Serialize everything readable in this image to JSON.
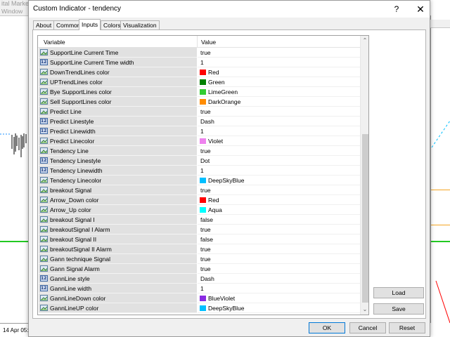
{
  "background": {
    "app_title_fragment": "ital Marke",
    "menu_fragment": "Window",
    "axis_label": "14 Apr 05:0"
  },
  "dialog": {
    "title": "Custom Indicator - tendency",
    "help_label": "?",
    "close_label": "✕",
    "tabs": [
      {
        "label": "About",
        "active": false
      },
      {
        "label": "Common",
        "active": false
      },
      {
        "label": "Inputs",
        "active": true
      },
      {
        "label": "Colors",
        "active": false
      },
      {
        "label": "Visualization",
        "active": false
      }
    ],
    "table": {
      "columns": {
        "variable": "Variable",
        "value": "Value"
      },
      "rows": [
        {
          "icon": "bool",
          "name": "SupportLine Current Time",
          "value": "true"
        },
        {
          "icon": "num",
          "name": "SupportLine Current Time width",
          "value": "1"
        },
        {
          "icon": "color",
          "name": "DownTrendLines color",
          "value": "Red",
          "swatch": "#ff0000"
        },
        {
          "icon": "color",
          "name": "UPTrendLines color",
          "value": "Green",
          "swatch": "#008000"
        },
        {
          "icon": "color",
          "name": "Bye SupportLines color",
          "value": "LimeGreen",
          "swatch": "#32cd32"
        },
        {
          "icon": "color",
          "name": "Sell SupportLines color",
          "value": "DarkOrange",
          "swatch": "#ff8c00"
        },
        {
          "icon": "bool",
          "name": "Predict Line",
          "value": "true"
        },
        {
          "icon": "num",
          "name": "Predict Linestyle",
          "value": "Dash"
        },
        {
          "icon": "num",
          "name": "Predict Linewidth",
          "value": "1"
        },
        {
          "icon": "color",
          "name": "Predict Linecolor",
          "value": "Violet",
          "swatch": "#ee82ee"
        },
        {
          "icon": "bool",
          "name": "Tendency Line",
          "value": "true"
        },
        {
          "icon": "num",
          "name": "Tendency Linestyle",
          "value": "Dot"
        },
        {
          "icon": "num",
          "name": "Tendency Linewidth",
          "value": "1"
        },
        {
          "icon": "color",
          "name": "Tendency Linecolor",
          "value": "DeepSkyBlue",
          "swatch": "#00bfff"
        },
        {
          "icon": "bool",
          "name": "breakout Signal",
          "value": "true"
        },
        {
          "icon": "color",
          "name": "Arrow_Down color",
          "value": "Red",
          "swatch": "#ff0000"
        },
        {
          "icon": "color",
          "name": "Arrow_Up color",
          "value": "Aqua",
          "swatch": "#00ffff"
        },
        {
          "icon": "bool",
          "name": "breakout Signal I",
          "value": "false"
        },
        {
          "icon": "bool",
          "name": "breakoutSignal I Alarm",
          "value": "true"
        },
        {
          "icon": "bool",
          "name": "breakout Signal II",
          "value": "false"
        },
        {
          "icon": "bool",
          "name": "breakoutSignal II Alarm",
          "value": "true"
        },
        {
          "icon": "bool",
          "name": "Gann technique Signal",
          "value": "true"
        },
        {
          "icon": "bool",
          "name": "Gann Signal Alarm",
          "value": "true"
        },
        {
          "icon": "num",
          "name": "GannLine style",
          "value": "Dash"
        },
        {
          "icon": "num",
          "name": "GannLine width",
          "value": "1"
        },
        {
          "icon": "color",
          "name": "GannLineDown color",
          "value": "BlueViolet",
          "swatch": "#8a2be2"
        },
        {
          "icon": "color",
          "name": "GannLineUP color",
          "value": "DeepSkyBlue",
          "swatch": "#00bfff"
        }
      ]
    },
    "buttons": {
      "load": "Load",
      "save": "Save",
      "ok": "OK",
      "cancel": "Cancel",
      "reset": "Reset"
    },
    "num_icon_glyph": "123"
  }
}
